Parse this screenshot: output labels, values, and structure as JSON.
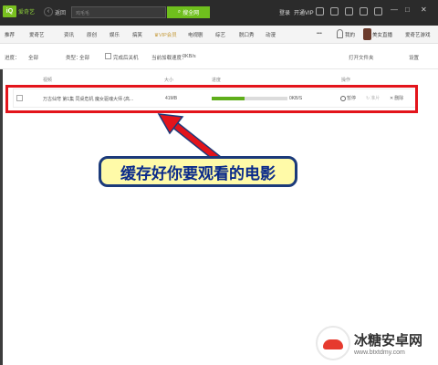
{
  "app": {
    "logo_text": "爱奇艺",
    "back_label": "返回",
    "search_placeholder": "鸡毛毛",
    "search_button": "搜全网",
    "login": "登录",
    "vip": "开通VIP",
    "window_controls": [
      "—",
      "□",
      "✕"
    ]
  },
  "nav": {
    "items": [
      "推荐",
      "爱奇艺",
      "资讯",
      "原创",
      "娱乐",
      "搞笑",
      "VIP会员",
      "电视剧",
      "综艺",
      "脱口秀",
      "动漫",
      "•••"
    ],
    "user_label": "我的",
    "live_label": "美女直播",
    "client_label": "爱奇艺游戏"
  },
  "toolbar": {
    "progress_label": "进度：",
    "progress_value": "全部",
    "type_label": "类型：",
    "type_value": "全部",
    "shutdown_label": "完成后关机",
    "speed_label": "当前加载速度：",
    "speed_value": "0KB/s",
    "open_folder": "打开文件夹",
    "settings": "设置"
  },
  "table": {
    "headers": [
      "视频",
      "大小",
      "进度",
      "操作"
    ],
    "rows": [
      {
        "title": "万古仙穹 第1集 同桌危机 魔女驱魂大师 (高...",
        "size": "41MB",
        "progress": 0.43,
        "speed": "0KB/S",
        "actions": [
          "暂停",
          "准片",
          "删除"
        ]
      }
    ]
  },
  "callout": {
    "text": "缓存好你要观看的电影"
  },
  "watermark": {
    "main": "冰糖安卓网",
    "sub": "www.btxtdmy.com"
  },
  "colors": {
    "brand_green": "#6fbf1d",
    "highlight_red": "#e3141b",
    "callout_bg": "#fffaa8",
    "callout_text": "#0a2a8a"
  }
}
